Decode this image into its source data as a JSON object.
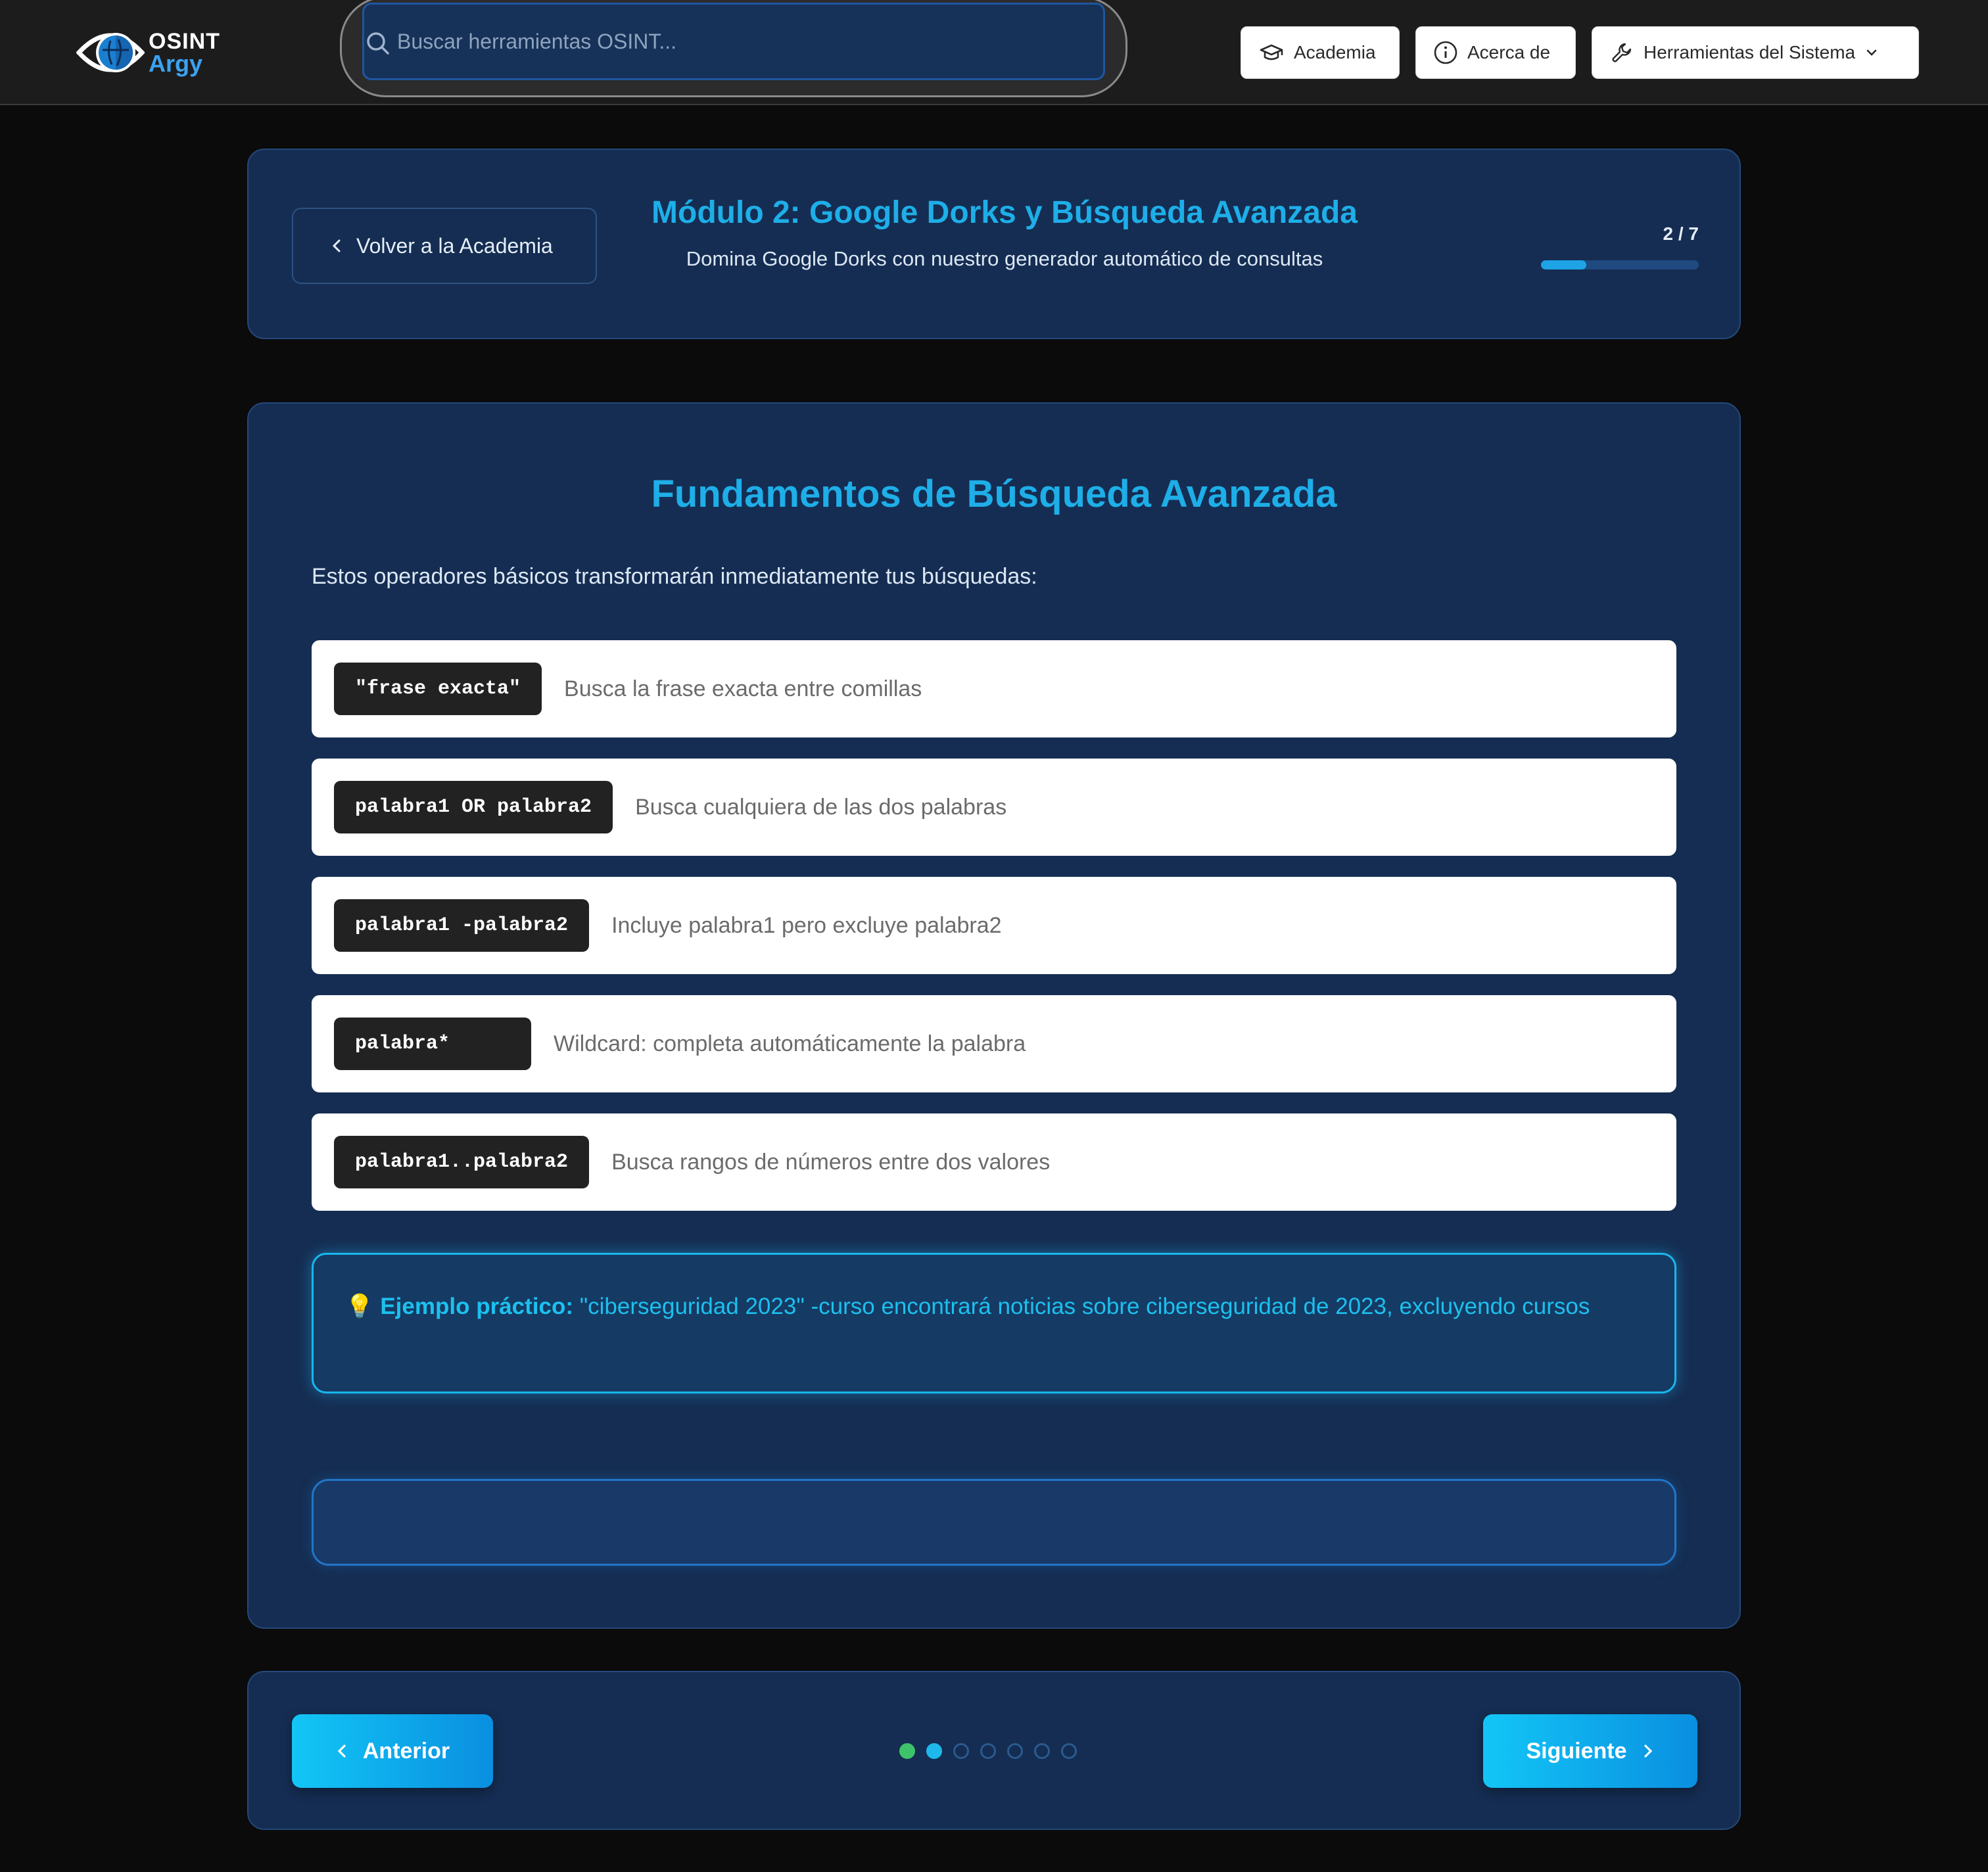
{
  "app": {
    "logo_line1": "OSINT",
    "logo_line2": "Argy"
  },
  "search": {
    "placeholder": "Buscar herramientas OSINT..."
  },
  "nav": {
    "academia": "Academia",
    "acerca": "Acerca de",
    "herramientas": "Herramientas del Sistema"
  },
  "module": {
    "back_label": "Volver a la Academia",
    "title": "Módulo 2: Google Dorks y Búsqueda Avanzada",
    "subtitle": "Domina Google Dorks con nuestro generador automático de consultas",
    "progress_label": "2 / 7",
    "progress_fraction": 0.2857
  },
  "lesson": {
    "title": "Fundamentos de Búsqueda Avanzada",
    "intro": "Estos operadores básicos transformarán inmediatamente tus búsquedas:",
    "operators": [
      {
        "code": "\"frase exacta\"",
        "desc": "Busca la frase exacta entre comillas"
      },
      {
        "code": "palabra1 OR palabra2",
        "desc": "Busca cualquiera de las dos palabras"
      },
      {
        "code": "palabra1 -palabra2",
        "desc": "Incluye palabra1 pero excluye palabra2"
      },
      {
        "code": "palabra*",
        "desc": "Wildcard: completa automáticamente la palabra"
      },
      {
        "code": "palabra1..palabra2",
        "desc": "Busca rangos de números entre dos valores"
      }
    ],
    "tip_icon": "💡",
    "tip_label": "Ejemplo práctico:",
    "tip_text": "\"ciberseguridad 2023\" -curso encontrará noticias sobre ciberseguridad de 2023, excluyendo cursos"
  },
  "footer": {
    "prev_label": "Anterior",
    "next_label": "Siguiente",
    "steps": [
      "done",
      "active",
      "pending",
      "pending",
      "pending",
      "pending",
      "pending"
    ]
  },
  "colors": {
    "accent": "#1eaee8",
    "card": "#152d52",
    "done_dot": "#3ec26a"
  }
}
